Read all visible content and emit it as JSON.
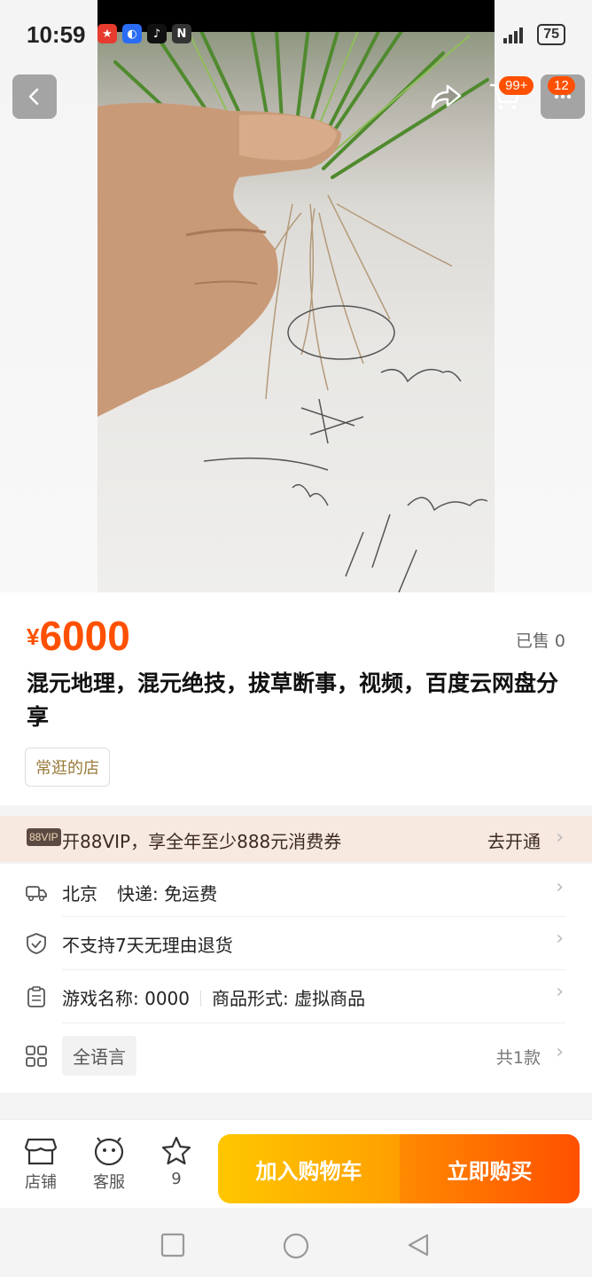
{
  "status_bar": {
    "time": "10:59",
    "battery": "75"
  },
  "header": {
    "cart_badge": "99+",
    "message_badge": "12"
  },
  "product": {
    "currency": "¥",
    "price": "6000",
    "sold": "已售 0",
    "title": "混元地理，混元绝技，拔草断事，视频，百度云网盘分享",
    "shop_tag": "常逛的店"
  },
  "vip_banner": {
    "logo": "88VIP",
    "text": "开88VIP，享全年至少888元消费券",
    "action": "去开通"
  },
  "info_rows": {
    "shipping": {
      "location": "北京",
      "express": "快递: 免运费"
    },
    "return_policy": "不支持7天无理由退货",
    "attrs": {
      "game_name": "游戏名称: 0000",
      "product_form": "商品形式: 虚拟商品"
    },
    "sku": {
      "option": "全语言",
      "count": "共1款"
    }
  },
  "bottom_bar": {
    "shop": "店铺",
    "service": "客服",
    "favorite_count": "9",
    "add_to_cart": "加入购物车",
    "buy_now": "立即购买"
  }
}
